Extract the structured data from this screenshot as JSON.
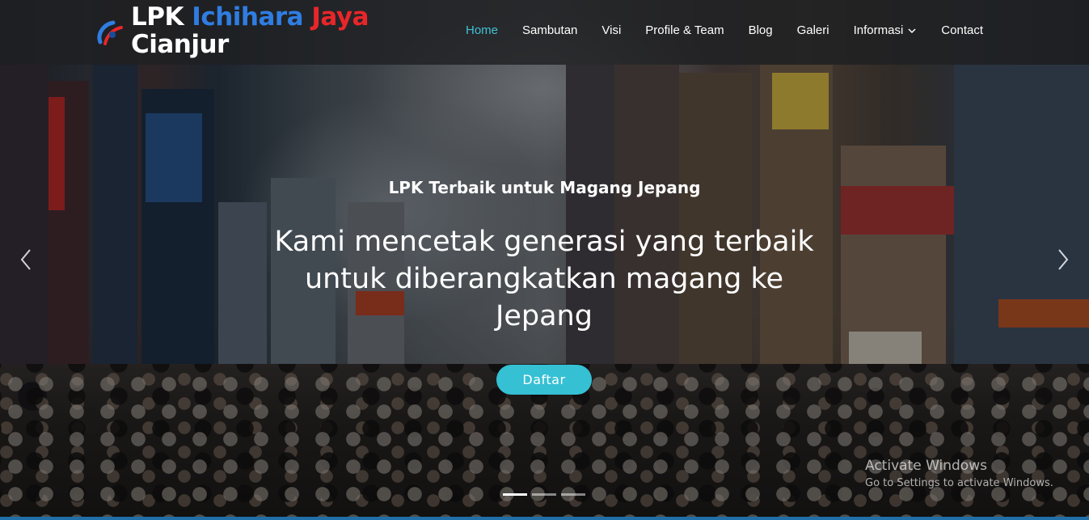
{
  "brand": {
    "line1_part1": "LPK ",
    "line1_part2": "Ichihara",
    "line1_part3": " Jaya",
    "line2": "Cianjur",
    "colors": {
      "white": "#ffffff",
      "blue": "#2f7de1",
      "red": "#e8262a"
    }
  },
  "nav": {
    "items": [
      {
        "label": "Home",
        "active": true
      },
      {
        "label": "Sambutan"
      },
      {
        "label": "Visi"
      },
      {
        "label": "Profile & Team"
      },
      {
        "label": "Blog"
      },
      {
        "label": "Galeri"
      },
      {
        "label": "Informasi",
        "icon": "chevron-down-icon"
      },
      {
        "label": "Contact"
      }
    ],
    "active_color": "#3fc1d6"
  },
  "hero": {
    "kicker": "LPK Terbaik untuk Magang Jepang",
    "headline": "Kami mencetak generasi yang terbaik untuk diberangkatkan magang ke Jepang",
    "cta_label": "Daftar",
    "cta_color": "#35c0d4",
    "slides_count": 3,
    "active_slide": 1
  },
  "watermark": {
    "title": "Activate Windows",
    "subtitle": "Go to Settings to activate Windows."
  }
}
